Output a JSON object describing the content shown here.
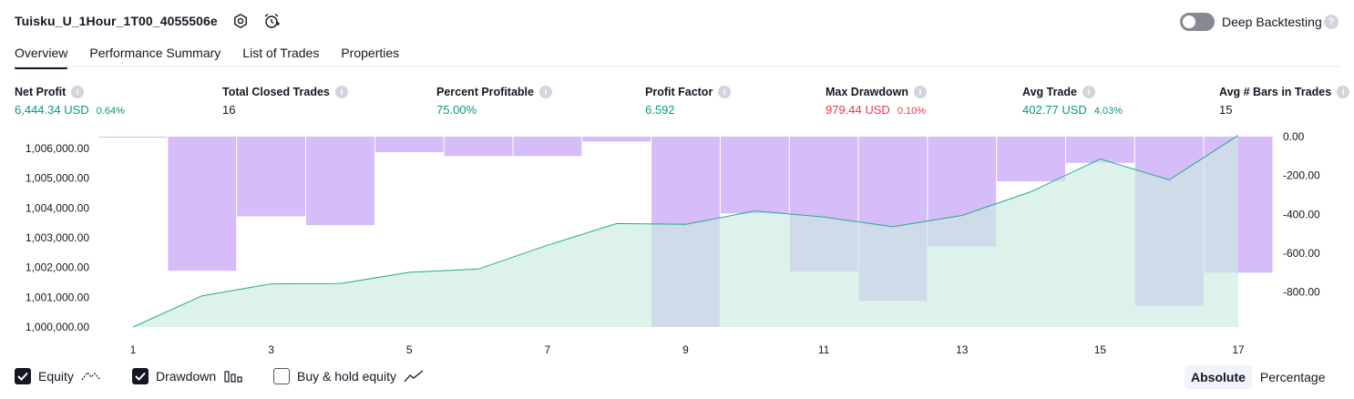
{
  "header": {
    "title": "Tuisku_U_1Hour_1T00_4055506e",
    "deep_backtesting_label": "Deep Backtesting",
    "help_mark": "?"
  },
  "tabs": [
    {
      "label": "Overview",
      "active": true
    },
    {
      "label": "Performance Summary",
      "active": false
    },
    {
      "label": "List of Trades",
      "active": false
    },
    {
      "label": "Properties",
      "active": false
    }
  ],
  "metrics": [
    {
      "label": "Net Profit",
      "value": "6,444.34 USD",
      "pct": "0.64%",
      "color": "#089981"
    },
    {
      "label": "Total Closed Trades",
      "value": "16",
      "pct": "",
      "color": "#131722"
    },
    {
      "label": "Percent Profitable",
      "value": "75.00%",
      "pct": "",
      "color": "#089981"
    },
    {
      "label": "Profit Factor",
      "value": "6.592",
      "pct": "",
      "color": "#089981"
    },
    {
      "label": "Max Drawdown",
      "value": "979.44 USD",
      "pct": "0.10%",
      "color": "#f23645"
    },
    {
      "label": "Avg Trade",
      "value": "402.77 USD",
      "pct": "4.03%",
      "color": "#089981"
    },
    {
      "label": "Avg # Bars in Trades",
      "value": "15",
      "pct": "",
      "color": "#131722"
    }
  ],
  "chart_data": {
    "type": "area",
    "x_ticks": [
      "1",
      "3",
      "5",
      "7",
      "9",
      "11",
      "13",
      "15",
      "17"
    ],
    "left_axis_ticks": [
      "1,006,000.00",
      "1,005,000.00",
      "1,004,000.00",
      "1,003,000.00",
      "1,002,000.00",
      "1,001,000.00",
      "1,000,000.00"
    ],
    "right_axis_ticks": [
      "0.00",
      "-200.00",
      "-400.00",
      "-600.00",
      "-800.00"
    ],
    "left_ylim": [
      1000000,
      1006400
    ],
    "right_ylim": [
      -979.44,
      0
    ],
    "equity": {
      "x": [
        1,
        2,
        3,
        4,
        5,
        6,
        7,
        8,
        9,
        10,
        11,
        12,
        13,
        14,
        15,
        16,
        17
      ],
      "values": [
        1000000,
        1001050,
        1001450,
        1001460,
        1001840,
        1001950,
        1002750,
        1003480,
        1003450,
        1003900,
        1003700,
        1003370,
        1003750,
        1004550,
        1005650,
        1004950,
        1006444
      ]
    },
    "drawdown": {
      "x": [
        1,
        2,
        3,
        4,
        5,
        6,
        7,
        8,
        9,
        10,
        11,
        12,
        13,
        14,
        15,
        16,
        17
      ],
      "values": [
        -5,
        -690,
        -410,
        -455,
        -80,
        -100,
        -100,
        -25,
        -979.44,
        -395,
        -695,
        -845,
        -565,
        -230,
        -135,
        -870,
        -700
      ]
    },
    "colors": {
      "equity_line": "#22ab94",
      "equity_fill": "#cdebe2",
      "drawdown_bar": "#cfb0f7"
    },
    "grid": false
  },
  "footer": {
    "equity_label": "Equity",
    "drawdown_label": "Drawdown",
    "buyhold_label": "Buy & hold equity",
    "equity_checked": true,
    "drawdown_checked": true,
    "buyhold_checked": false,
    "absolute_label": "Absolute",
    "percentage_label": "Percentage",
    "selected_mode": "Absolute"
  }
}
